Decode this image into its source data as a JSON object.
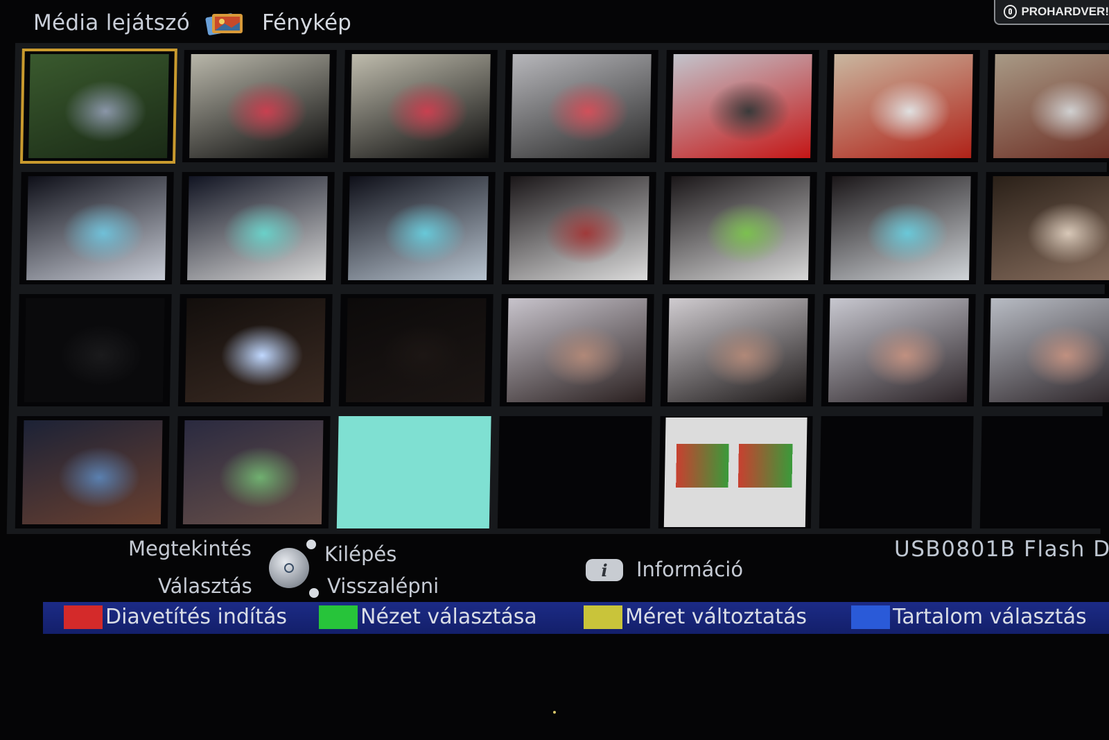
{
  "header": {
    "app_title": "Média lejátszó",
    "section_title": "Fénykép",
    "section_icon": "photo-stack-icon"
  },
  "watermark": {
    "text": "PROHARDVER!",
    "icon": "prohardver-logo-icon"
  },
  "grid": {
    "columns": 7,
    "rows": 4,
    "selected_index": 0,
    "thumbnails": [
      {
        "kind": "photo",
        "colors": [
          "#3a5a2e",
          "#1a2a16",
          "#8a96a8"
        ]
      },
      {
        "kind": "photo",
        "colors": [
          "#b9b7aa",
          "#0c0c0c",
          "#c84050"
        ]
      },
      {
        "kind": "photo",
        "colors": [
          "#bfbcad",
          "#0c0c0c",
          "#c84050"
        ]
      },
      {
        "kind": "photo",
        "colors": [
          "#b7b7bb",
          "#2a2a2a",
          "#d0505a"
        ]
      },
      {
        "kind": "photo",
        "colors": [
          "#c2c4cc",
          "#c41616",
          "#3a3a3a"
        ]
      },
      {
        "kind": "photo",
        "colors": [
          "#c9b7a0",
          "#b02218",
          "#e0e0e0"
        ]
      },
      {
        "kind": "photo",
        "colors": [
          "#a89a86",
          "#6a2a20",
          "#d0d0d0"
        ]
      },
      {
        "kind": "photo",
        "colors": [
          "#0e0f18",
          "#c8ccd6",
          "#70c0d8"
        ]
      },
      {
        "kind": "photo",
        "colors": [
          "#111422",
          "#d8d8d8",
          "#6ad0c8"
        ]
      },
      {
        "kind": "photo",
        "colors": [
          "#0e0f18",
          "#b8c4d0",
          "#68c8d8"
        ]
      },
      {
        "kind": "photo",
        "colors": [
          "#1a1618",
          "#dcdcdc",
          "#a03a3a"
        ]
      },
      {
        "kind": "photo",
        "colors": [
          "#1a1618",
          "#d8d8d8",
          "#7cc050"
        ]
      },
      {
        "kind": "photo",
        "colors": [
          "#1a1618",
          "#d0d4d8",
          "#6ac8d8"
        ]
      },
      {
        "kind": "photo",
        "colors": [
          "#2a2018",
          "#8a7060",
          "#d8c8b8"
        ]
      },
      {
        "kind": "photo",
        "colors": [
          "#0a0a0c",
          "#0a0a0c",
          "#1a1a1c"
        ]
      },
      {
        "kind": "photo",
        "colors": [
          "#120e0c",
          "#3a2a22",
          "#c0d8ff"
        ]
      },
      {
        "kind": "photo",
        "colors": [
          "#0c0a0a",
          "#1c1614",
          "#1c1614"
        ]
      },
      {
        "kind": "photo",
        "colors": [
          "#c8c4cc",
          "#2a2020",
          "#b08878"
        ]
      },
      {
        "kind": "photo",
        "colors": [
          "#d0ccd0",
          "#1c1818",
          "#b08878"
        ]
      },
      {
        "kind": "photo",
        "colors": [
          "#c8c8d0",
          "#2a2226",
          "#c09080"
        ]
      },
      {
        "kind": "photo",
        "colors": [
          "#b8bcc4",
          "#2a2226",
          "#c09080"
        ]
      },
      {
        "kind": "photo",
        "colors": [
          "#1c2236",
          "#6a4030",
          "#5a80b0"
        ]
      },
      {
        "kind": "photo",
        "colors": [
          "#2a2a40",
          "#6a5048",
          "#70b070"
        ]
      },
      {
        "kind": "teal",
        "colors": [
          "#7fe0d2"
        ]
      },
      {
        "kind": "empty",
        "colors": []
      },
      {
        "kind": "report",
        "colors": [
          "#dcdcdc",
          "#c84030",
          "#3a9a3a"
        ]
      },
      {
        "kind": "empty",
        "colors": []
      },
      {
        "kind": "empty",
        "colors": []
      }
    ]
  },
  "controls": {
    "view": "Megtekintés",
    "select": "Választás",
    "exit": "Kilépés",
    "back": "Visszalépni",
    "remote_icon": "remote-dpad-icon",
    "info_icon_glyph": "i",
    "info_label": "Információ",
    "device_name": "USB0801B Flash D"
  },
  "color_bar": [
    {
      "key": "red",
      "color": "#d42a2a",
      "label": "Diavetítés indítás"
    },
    {
      "key": "green",
      "color": "#27c43a",
      "label": "Nézet választása"
    },
    {
      "key": "yellow",
      "color": "#c9c43a",
      "label": "Méret változtatás"
    },
    {
      "key": "blue",
      "color": "#2a5ad8",
      "label": "Tartalom választás"
    }
  ]
}
